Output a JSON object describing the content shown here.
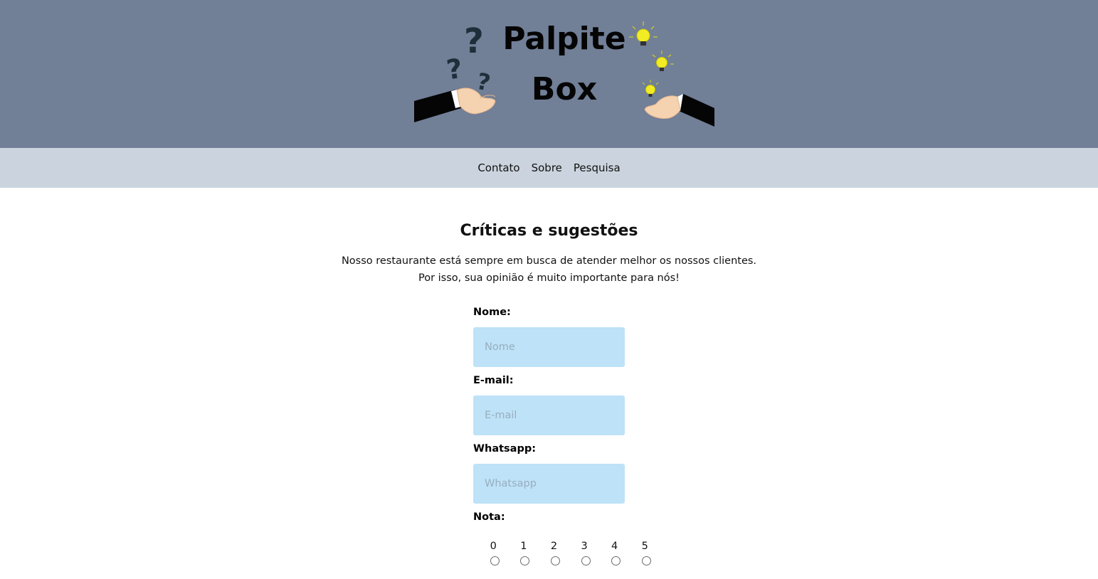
{
  "header": {
    "logo_line1": "Palpite",
    "logo_line2": "Box",
    "logo_icons": [
      "question-mark-icon",
      "light-bulb-icon",
      "hand-icon"
    ]
  },
  "nav": {
    "items": [
      "Contato",
      "Sobre",
      "Pesquisa"
    ]
  },
  "main": {
    "title": "Críticas e sugestões",
    "intro_line1": "Nosso restaurante está sempre em busca de atender melhor os nossos clientes.",
    "intro_line2": "Por isso, sua opinião é muito importante para nós!"
  },
  "form": {
    "name_label": "Nome:",
    "name_placeholder": "Nome",
    "email_label": "E-mail:",
    "email_placeholder": "E-mail",
    "whatsapp_label": "Whatsapp:",
    "whatsapp_placeholder": "Whatsapp",
    "rating_label": "Nota:",
    "rating_options": [
      "0",
      "1",
      "2",
      "3",
      "4",
      "5"
    ]
  },
  "colors": {
    "header_bg": "#717f97",
    "nav_bg": "#cbd4de",
    "input_bg": "#bee2f7",
    "bulb": "#f2ec24"
  }
}
